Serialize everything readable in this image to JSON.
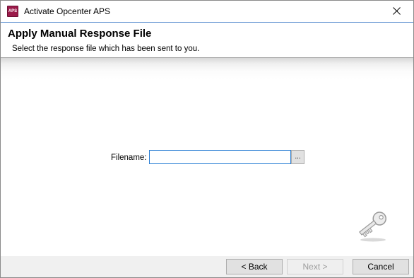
{
  "window": {
    "title": "Activate Opcenter APS",
    "icon_text": "APS",
    "close_icon": "close-icon"
  },
  "header": {
    "title": "Apply Manual Response File",
    "subtitle": "Select the response file which has been sent to you."
  },
  "form": {
    "filename_label": "Filename:",
    "filename_value": "",
    "browse_label": "..."
  },
  "decor": {
    "key_icon": "key-icon"
  },
  "footer": {
    "back_label": "< Back",
    "next_label": "Next >",
    "cancel_label": "Cancel"
  },
  "colors": {
    "app_icon": "#9b1b4a",
    "input_focus_border": "#2b7fd4",
    "footer_bg": "#f0f0f0"
  }
}
